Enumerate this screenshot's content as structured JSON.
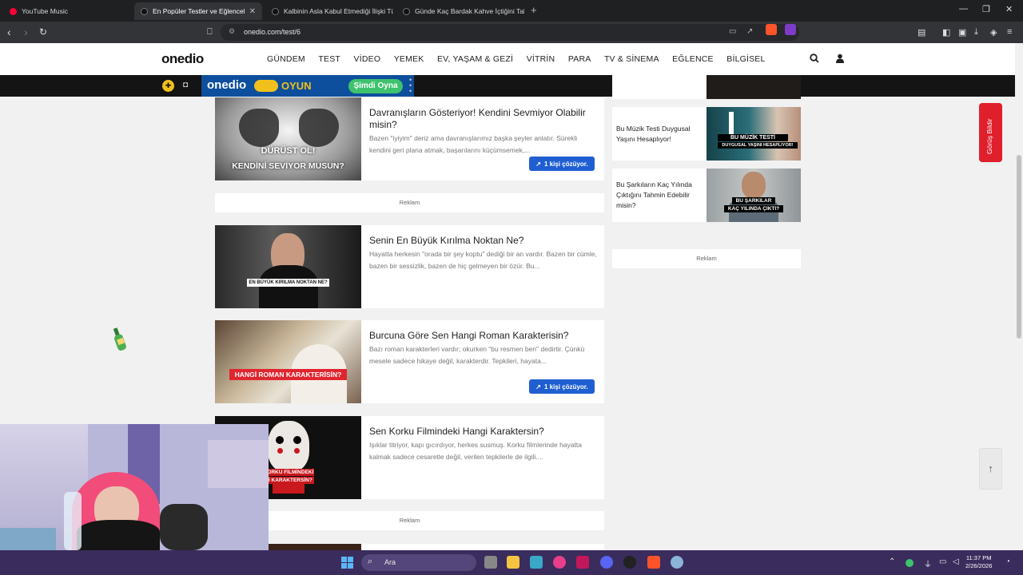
{
  "browser": {
    "tabs": [
      {
        "title": "YouTube Music",
        "favicon_color": "#ff0033"
      },
      {
        "title": "En Popüler Testler ve Eğlenceli Q",
        "favicon_color": "#222222"
      },
      {
        "title": "Kalbinin Asla Kabul Etmediği İlişki Tür",
        "favicon_color": "#222222"
      },
      {
        "title": "Günde Kaç Bardak Kahve İçtiğini Tahm",
        "favicon_color": "#222222"
      }
    ],
    "new_tab_icon": "+",
    "url": "onedio.com/test/6",
    "window_controls": {
      "minimize": "—",
      "maximize": "❐",
      "close": "✕"
    }
  },
  "site": {
    "logo": "onedio",
    "nav": [
      "GÜNDEM",
      "TEST",
      "VİDEO",
      "YEMEK",
      "EV, YAŞAM & GEZİ",
      "VİTRİN",
      "PARA",
      "TV & SİNEMA",
      "EĞLENCE",
      "BİLGİSEL"
    ],
    "oyun_banner": {
      "logo": "onedio",
      "label": "OYUN",
      "cta": "Şimdi Oyna"
    }
  },
  "cards": [
    {
      "title": "Davranışların Gösteriyor! Kendini Sevmiyor Olabilir misin?",
      "desc": "Bazen \"iyiyim\" deriz ama davranışlarımız başka şeyler anlatır. Sürekli kendini geri plana atmak, başarılarını küçümsemek,...",
      "badge": "1 kişi çözüyor.",
      "thumb_caption_1": "DÜRÜST OL!",
      "thumb_caption_2": "KENDİNİ SEVİYOR MUSUN?"
    },
    {
      "title": "Senin En Büyük Kırılma Noktan Ne?",
      "desc": "Hayatta herkesin \"orada bir şey koptu\" dediği bir an vardır. Bazen bir cümle, bazen bir sessizlik, bazen de hiç gelmeyen bir özür. Bu...",
      "thumb_caption_1": "EN BÜYÜK KIRILMA NOKTAN NE?"
    },
    {
      "title": "Burcuna Göre Sen Hangi Roman Karakterisin?",
      "desc": "Bazı roman karakterleri vardır; okurken \"bu resmen ben\" dedirtir. Çünkü mesele sadece hikaye değil, karakterdir. Tepkileri, hayata...",
      "badge": "1 kişi çözüyor.",
      "thumb_caption_1": "HANGİ ROMAN KARAKTERİSİN?"
    },
    {
      "title": "Sen Korku Filmindeki Hangi Karaktersin?",
      "desc": "Işıklar titriyor, kapı gıcırdıyor, herkes susmuş. Korku filmlerinde hayatta kalmak sadece cesaretle değil, verilen tepkilerle de ilgili....",
      "thumb_caption_1": "KORKU FİLMİNDEKİ",
      "thumb_caption_2": "Hİ KARAKTERSİN?"
    }
  ],
  "ad_label": "Reklam",
  "sidebar": [
    {
      "title": "Bu Müzik Testi Duygusal Yaşını Hesaplıyor!",
      "thumb_caption_1": "BU MÜZİK TESTİ",
      "thumb_caption_2": "DUYGUSAL YAŞINI HESAPLIYOR!"
    },
    {
      "title": "Bu Şarkıların Kaç Yılında Çıktığını Tahmin Edebilir misin?",
      "thumb_caption_1": "BU ŞARKILAR",
      "thumb_caption_2": "KAÇ YILINDA ÇIKTI?"
    }
  ],
  "feedback": "Görüş Bildir",
  "scroll_top_icon": "↑",
  "taskbar": {
    "search_label": "Ara",
    "time": "11:37 PM",
    "date": "2/26/2026"
  },
  "colors": {
    "accent_blue": "#1f5fd2",
    "feedback_red": "#e01f2c",
    "oyun_green": "#3ec26d",
    "oyun_yellow": "#f2c01c"
  }
}
